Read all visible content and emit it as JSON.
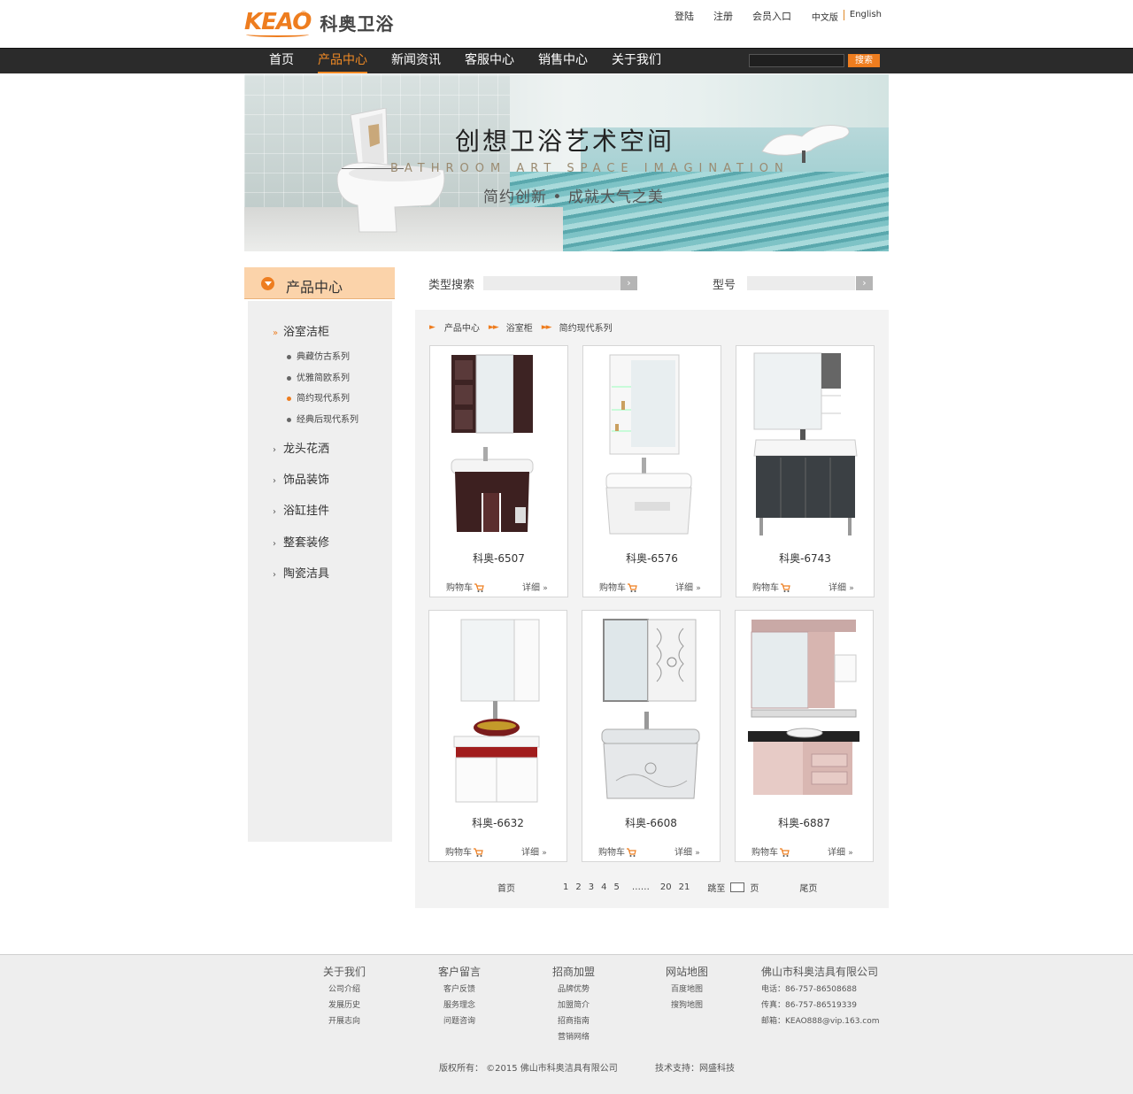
{
  "header": {
    "logo_mark": "KEAO",
    "logo_reg": "®",
    "logo_text": "科奥卫浴",
    "links": [
      "登陆",
      "注册",
      "会员入口"
    ],
    "lang_cn": "中文版",
    "lang_en": "English"
  },
  "nav": {
    "items": [
      "首页",
      "产品中心",
      "新闻资讯",
      "客服中心",
      "销售中心",
      "关于我们"
    ],
    "search_button": "搜索"
  },
  "banner": {
    "title": "创想卫浴艺术空间",
    "subtitle_en": "BATHROOM ART SPACE IMAGINATION",
    "subtitle": "简约创新 • 成就大气之美"
  },
  "sidebar": {
    "title": "产品中心",
    "categories": [
      "浴室洁柜",
      "龙头花洒",
      "饰品装饰",
      "浴缸挂件",
      "整套装修",
      "陶瓷洁具"
    ],
    "subcategories": [
      "典藏仿古系列",
      "优雅简欧系列",
      "简约现代系列",
      "经典后现代系列"
    ]
  },
  "filter": {
    "type_label": "类型搜索",
    "model_label": "型号",
    "go": "›"
  },
  "breadcrumb": [
    "产品中心",
    "浴室柜",
    "简约现代系列"
  ],
  "products": [
    {
      "name": "科奥-6507",
      "cart": "购物车",
      "detail": "详细"
    },
    {
      "name": "科奥-6576",
      "cart": "购物车",
      "detail": "详细"
    },
    {
      "name": "科奥-6743",
      "cart": "购物车",
      "detail": "详细"
    },
    {
      "name": "科奥-6632",
      "cart": "购物车",
      "detail": "详细"
    },
    {
      "name": "科奥-6608",
      "cart": "购物车",
      "detail": "详细"
    },
    {
      "name": "科奥-6887",
      "cart": "购物车",
      "detail": "详细"
    }
  ],
  "pager": {
    "first": "首页",
    "pages": [
      "1",
      "2",
      "3",
      "4",
      "5"
    ],
    "ellipsis": "……",
    "tail_pages": [
      "20",
      "21"
    ],
    "jump": "跳至",
    "page_unit": "页",
    "last": "尾页"
  },
  "footer": {
    "cols": [
      {
        "title": "关于我们",
        "links": [
          "公司介绍",
          "发展历史",
          "开展志向"
        ]
      },
      {
        "title": "客户留言",
        "links": [
          "客户反馈",
          "服务理念",
          "问题咨询"
        ]
      },
      {
        "title": "招商加盟",
        "links": [
          "品牌优势",
          "加盟简介",
          "招商指南",
          "营销网络"
        ]
      },
      {
        "title": "网站地图",
        "links": [
          "百度地图",
          "搜狗地图"
        ]
      }
    ],
    "company": "佛山市科奥洁具有限公司",
    "phone": "电话：86-757-86508688",
    "fax": "传真：86-757-86519339",
    "email": "邮箱：KEAO888@vip.163.com",
    "copyright": "版权所有：  ©2015 佛山市科奥洁具有限公司",
    "tech": "技术支持：网盛科技"
  },
  "colors": {
    "accent": "#ee7d1f",
    "nav_bg": "#2b2b2b"
  }
}
